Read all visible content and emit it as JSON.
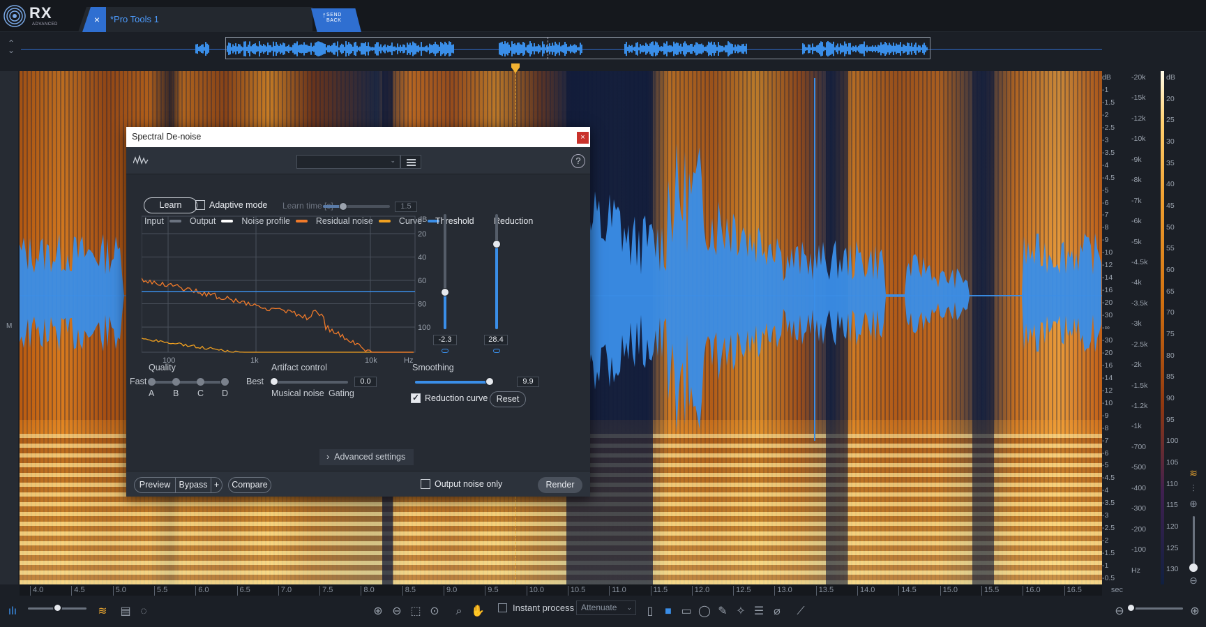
{
  "app": {
    "name": "RX",
    "edition": "ADVANCED"
  },
  "tab": {
    "title": "*Pro Tools 1",
    "close": "×"
  },
  "send_back": {
    "line1": "SEND",
    "line2": "BACK",
    "arrow": "↑"
  },
  "left_rail": {
    "channel": "M"
  },
  "scales": {
    "db_left": [
      "dB",
      "-1",
      "-1.5",
      "-2",
      "-2.5",
      "-3",
      "-3.5",
      "-4",
      "-4.5",
      "-5",
      "-6",
      "-7",
      "-8",
      "-9",
      "-10",
      "-12",
      "-14",
      "-16",
      "-20",
      "-30",
      "-∞",
      "-30",
      "-20",
      "-16",
      "-14",
      "-12",
      "-10",
      "-9",
      "-8",
      "-7",
      "-6",
      "-5",
      "-4.5",
      "-4",
      "-3.5",
      "-3",
      "-2.5",
      "-2",
      "-1.5",
      "-1",
      "-0.5"
    ],
    "hz": [
      "-20k",
      "-15k",
      "-12k",
      "-10k",
      "-9k",
      "-8k",
      "-7k",
      "-6k",
      "-5k",
      "-4.5k",
      "-4k",
      "-3.5k",
      "-3k",
      "-2.5k",
      "-2k",
      "-1.5k",
      "-1.2k",
      "-1k",
      "-700",
      "-500",
      "-400",
      "-300",
      "-200",
      "-100",
      "Hz"
    ],
    "colorbar_db": [
      "dB",
      "20",
      "25",
      "30",
      "35",
      "40",
      "45",
      "50",
      "55",
      "60",
      "65",
      "70",
      "75",
      "80",
      "85",
      "90",
      "95",
      "100",
      "105",
      "110",
      "115",
      "120",
      "125",
      "130"
    ]
  },
  "time_ruler": {
    "ticks": [
      "4.0",
      "4.5",
      "5.0",
      "5.5",
      "6.0",
      "6.5",
      "7.0",
      "7.5",
      "8.0",
      "8.5",
      "9.0",
      "9.5",
      "10.0",
      "10.5",
      "11.0",
      "11.5",
      "12.0",
      "12.5",
      "13.0",
      "13.5",
      "14.0",
      "14.5",
      "15.0",
      "15.5",
      "16.0",
      "16.5"
    ],
    "unit": "sec"
  },
  "bottom_toolbar": {
    "instant_process": "Instant process",
    "mode": "Attenuate",
    "icons": [
      "waveform-view-icon",
      "zoom-slider",
      "spectrogram-toggle-icon",
      "notes-icon",
      "chat-icon",
      "zoom-in-icon",
      "zoom-out-icon",
      "zoom-selection-icon",
      "zoom-fit-icon",
      "magnifier-icon",
      "hand-icon",
      "time-select-icon",
      "rect-select-icon",
      "freq-select-icon",
      "lasso-icon",
      "brush-icon",
      "magic-wand-icon",
      "harmonic-select-icon",
      "attenuate-icon",
      "pencil-icon"
    ]
  },
  "dialog": {
    "title": "Spectral De-noise",
    "close": "×",
    "preset": "",
    "help": "?",
    "learn": "Learn",
    "adaptive_mode": "Adaptive mode",
    "adaptive_checked": false,
    "learn_time_label": "Learn time [s]",
    "learn_time_value": "1.5",
    "learn_time_level": 0.3,
    "legend": [
      {
        "label": "Input",
        "color": "#6b7380"
      },
      {
        "label": "Output",
        "color": "#ffffff"
      },
      {
        "label": "Noise profile",
        "color": "#f07a2a"
      },
      {
        "label": "Residual noise",
        "color": "#f0a020"
      },
      {
        "label": "Curve",
        "color": "#3a8ee8"
      }
    ],
    "graph": {
      "y_unit": "dB",
      "y_ticks": [
        "20",
        "40",
        "60",
        "80",
        "100"
      ],
      "x_ticks": [
        "100",
        "1k",
        "10k"
      ],
      "x_unit": "Hz"
    },
    "threshold": {
      "label": "Threshold",
      "value": "-2.3",
      "level": 0.32
    },
    "reduction": {
      "label": "Reduction",
      "value": "28.4",
      "level": 0.74
    },
    "quality": {
      "label": "Quality",
      "fast": "Fast",
      "best": "Best",
      "options": [
        "A",
        "B",
        "C",
        "D"
      ],
      "selected": "D"
    },
    "artifact_control": {
      "label": "Artifact control",
      "value": "0.0",
      "left": "Musical noise",
      "right": "Gating",
      "level": 0.0
    },
    "smoothing": {
      "label": "Smoothing",
      "value": "9.9",
      "level": 0.99
    },
    "reduction_curve": "Reduction curve",
    "reduction_curve_checked": true,
    "reset": "Reset",
    "advanced_settings": "Advanced settings",
    "footer": {
      "preview": "Preview",
      "bypass": "Bypass",
      "plus": "+",
      "compare": "Compare",
      "output_noise_only": "Output noise only",
      "render": "Render"
    }
  }
}
